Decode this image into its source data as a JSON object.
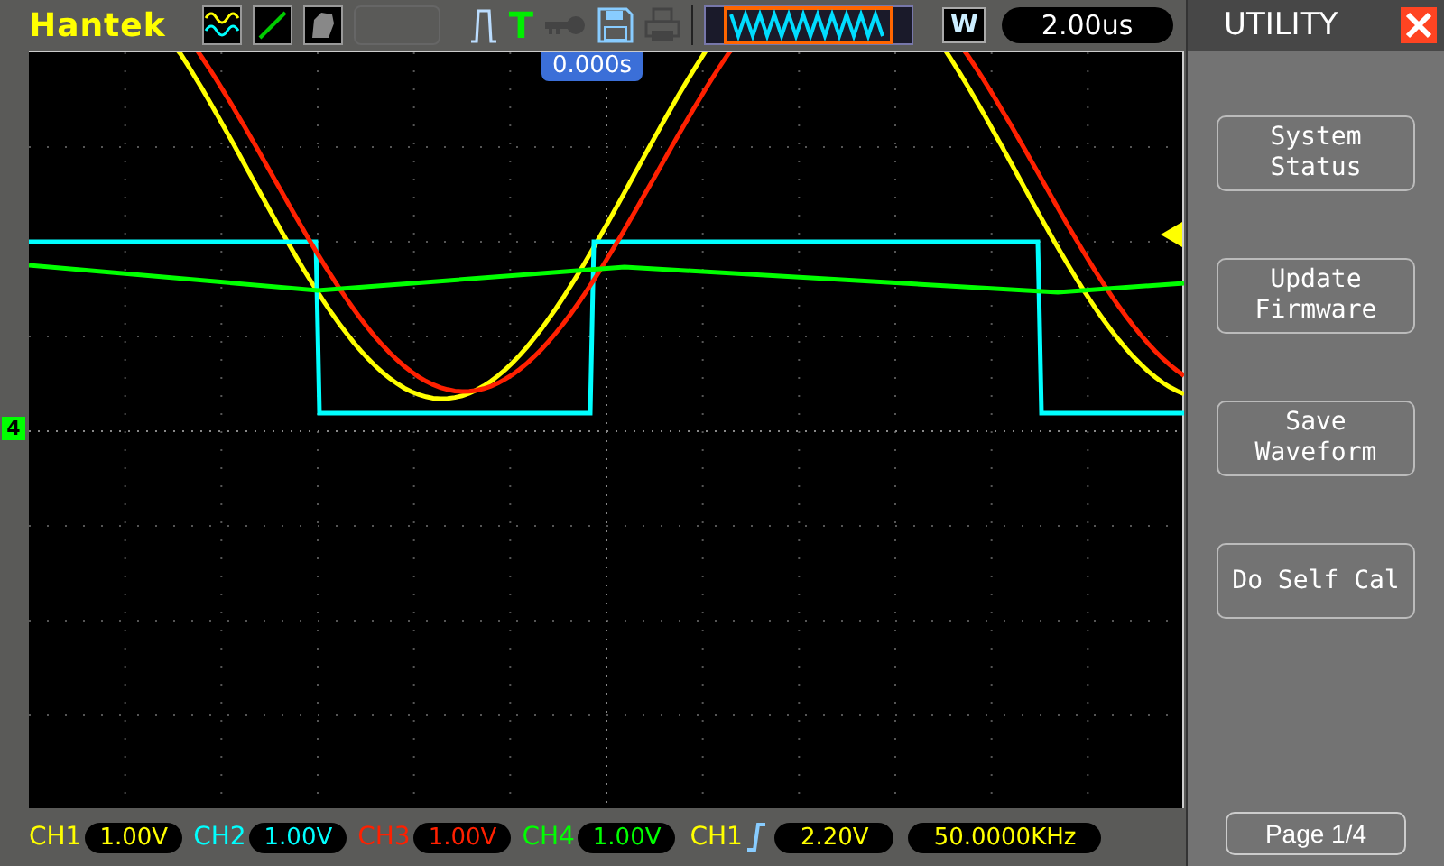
{
  "header": {
    "logo": "Hantek",
    "trigger_status": "T",
    "memory_window_label": "W",
    "timebase": "2.00us"
  },
  "screen": {
    "time_offset": "0.000s",
    "channel_marker": "4"
  },
  "menu": {
    "title": "UTILITY",
    "buttons": [
      {
        "lines": [
          "System",
          "Status"
        ]
      },
      {
        "lines": [
          "Update",
          "Firmware"
        ]
      },
      {
        "lines": [
          "Save",
          "Waveform"
        ]
      },
      {
        "lines": [
          "Do Self Cal"
        ]
      }
    ],
    "page": "Page 1/4"
  },
  "channels": [
    {
      "label": "CH1",
      "scale": "1.00V",
      "color": "#ffff00"
    },
    {
      "label": "CH2",
      "scale": "1.00V",
      "color": "#00ffff"
    },
    {
      "label": "CH3",
      "scale": "1.00V",
      "color": "#ff2000"
    },
    {
      "label": "CH4",
      "scale": "1.00V",
      "color": "#00ff00"
    }
  ],
  "trigger": {
    "source": "CH1",
    "level": "2.20V",
    "frequency": "50.0000KHz"
  }
}
